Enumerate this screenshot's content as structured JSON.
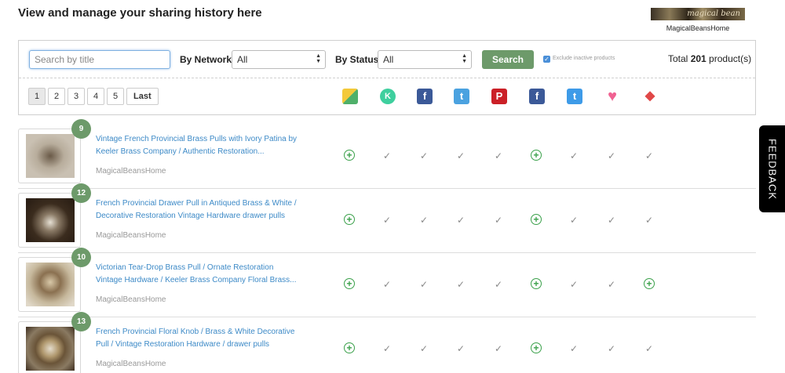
{
  "header": {
    "title": "View and manage your sharing history here",
    "shop_logo_text": "magical bean",
    "shop_name": "MagicalBeansHome"
  },
  "filters": {
    "search_placeholder": "Search by title",
    "network_label": "By Network",
    "network_value": "All",
    "status_label": "By Status",
    "status_value": "All",
    "search_button": "Search",
    "exclude_inactive_label": "Exclude inactive products",
    "exclude_inactive_checked": true,
    "total_prefix": "Total ",
    "total_count": "201",
    "total_suffix": " product(s)"
  },
  "pagination": {
    "pages": [
      "1",
      "2",
      "3",
      "4",
      "5"
    ],
    "active": "1",
    "last_label": "Last"
  },
  "networks": [
    {
      "name": "buffer-icon",
      "color": "#f3c93a",
      "glyph": ""
    },
    {
      "name": "kippt-icon",
      "color": "#3ecf9e",
      "glyph": "K"
    },
    {
      "name": "facebook-icon",
      "color": "#3b5998",
      "glyph": "f"
    },
    {
      "name": "twitter-icon",
      "color": "#4ba2e0",
      "glyph": "t"
    },
    {
      "name": "pinterest-icon",
      "color": "#cb2027",
      "glyph": "P"
    },
    {
      "name": "facebook-page-icon",
      "color": "#3b5998",
      "glyph": "f"
    },
    {
      "name": "tumblr-icon",
      "color": "#3e9be8",
      "glyph": "t"
    },
    {
      "name": "heart-icon",
      "color": "#f06292",
      "glyph": "♥"
    },
    {
      "name": "diamond-icon",
      "color": "#e04848",
      "glyph": "◆"
    }
  ],
  "products": [
    {
      "badge": "9",
      "title": "Vintage French Provincial Brass Pulls with Ivory Patina by Keeler Brass Company / Authentic Restoration...",
      "shop": "MagicalBeansHome",
      "statuses": [
        "plus",
        "check",
        "check",
        "check",
        "check",
        "plus",
        "check",
        "check",
        "check"
      ]
    },
    {
      "badge": "12",
      "title": "French Provincial Drawer Pull in Antiqued Brass & White / Decorative Restoration Vintage Hardware drawer pulls",
      "shop": "MagicalBeansHome",
      "statuses": [
        "plus",
        "check",
        "check",
        "check",
        "check",
        "plus",
        "check",
        "check",
        "check"
      ]
    },
    {
      "badge": "10",
      "title": "Victorian Tear-Drop Brass Pull / Ornate Restoration Vintage Hardware / Keeler Brass Company Floral Brass...",
      "shop": "MagicalBeansHome",
      "statuses": [
        "plus",
        "check",
        "check",
        "check",
        "check",
        "plus",
        "check",
        "check",
        "plus"
      ]
    },
    {
      "badge": "13",
      "title": "French Provincial Floral Knob / Brass & White Decorative Pull / Vintage Restoration Hardware / drawer pulls",
      "shop": "MagicalBeansHome",
      "statuses": [
        "plus",
        "check",
        "check",
        "check",
        "check",
        "plus",
        "check",
        "check",
        "check"
      ]
    }
  ],
  "feedback_label": "FEEDBACK"
}
